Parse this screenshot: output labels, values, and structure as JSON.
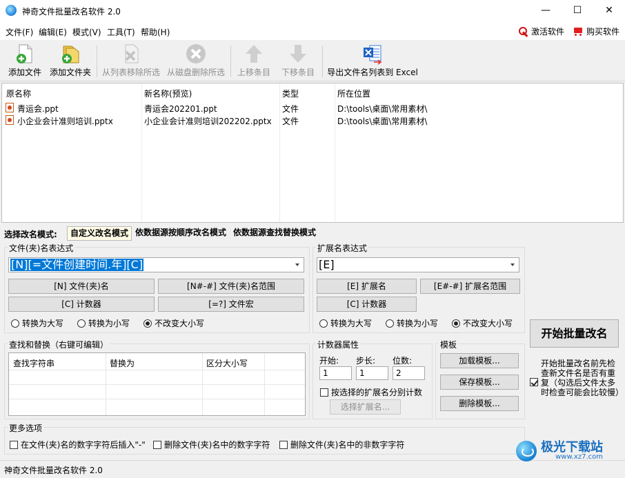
{
  "window": {
    "title": "神奇文件批量改名软件 2.0",
    "min_glyph": "—",
    "max_glyph": "☐",
    "close_glyph": "✕"
  },
  "menu": {
    "items": [
      "文件(F)",
      "编辑(E)",
      "模式(V)",
      "工具(T)",
      "帮助(H)"
    ],
    "activate": "激活软件",
    "buy": "购买软件"
  },
  "toolbar": {
    "add_file": "添加文件",
    "add_folder": "添加文件夹",
    "remove_from_list": "从列表移除所选",
    "delete_from_disk": "从磁盘删除所选",
    "move_up": "上移条目",
    "move_down": "下移条目",
    "export_excel": "导出文件名列表到 Excel"
  },
  "file_list": {
    "columns": [
      "原名称",
      "新名称(预览)",
      "类型",
      "所在位置"
    ],
    "rows": [
      {
        "original": "青运会.ppt",
        "preview": "青运会202201.ppt",
        "type": "文件",
        "location": "D:\\tools\\桌面\\常用素材\\"
      },
      {
        "original": "小企业会计准则培训.pptx",
        "preview": "小企业会计准则培训202202.pptx",
        "type": "文件",
        "location": "D:\\tools\\桌面\\常用素材\\"
      }
    ]
  },
  "mode": {
    "label": "选择改名模式:",
    "tabs": [
      "自定义改名模式",
      "依数据源按顺序改名模式",
      "依数据源查找替换模式"
    ],
    "active_index": 0
  },
  "name_expr": {
    "title": "文件(夹)名表达式",
    "value": "[N][=文件创建时间.年][C]",
    "btn_name": "[N] 文件(夹)名",
    "btn_name_range": "[N#-#] 文件(夹)名范围",
    "btn_counter": "[C] 计数器",
    "btn_macro": "[=?] 文件宏",
    "case_upper": "转换为大写",
    "case_lower": "转换为小写",
    "case_keep": "不改变大小写",
    "case_selected": "keep"
  },
  "ext_expr": {
    "title": "扩展名表达式",
    "value": "[E]",
    "btn_ext": "[E] 扩展名",
    "btn_ext_range": "[E#-#] 扩展名范围",
    "btn_counter": "[C] 计数器",
    "case_upper": "转换为大写",
    "case_lower": "转换为小写",
    "case_keep": "不改变大小写",
    "case_selected": "keep"
  },
  "find_replace": {
    "title": "查找和替换（右键可编辑）",
    "columns": [
      "查找字符串",
      "替换为",
      "区分大小写"
    ]
  },
  "counter": {
    "title": "计数器属性",
    "start_label": "开始:",
    "step_label": "步长:",
    "digits_label": "位数:",
    "start": "1",
    "step": "1",
    "digits": "2",
    "per_ext_label": "按选择的扩展名分别计数",
    "per_ext_checked": false,
    "choose_ext": "选择扩展名..."
  },
  "template": {
    "title": "模板",
    "load": "加载模板...",
    "save": "保存模板...",
    "delete": "删除模板..."
  },
  "start": {
    "button": "开始批量改名",
    "check_label": "开始批量改名前先检查新文件名是否有重复（勾选后文件太多时检查可能会比较慢）",
    "checked": true
  },
  "more": {
    "title": "更多选项",
    "opt1": "在文件(夹)名的数字字符后插入\"-\"",
    "opt2": "删除文件(夹)名中的数字字符",
    "opt3": "删除文件(夹)名中的非数字字符"
  },
  "status": "神奇文件批量改名软件 2.0",
  "watermark": {
    "name": "极光下载站",
    "url": "www.xz7.com"
  }
}
